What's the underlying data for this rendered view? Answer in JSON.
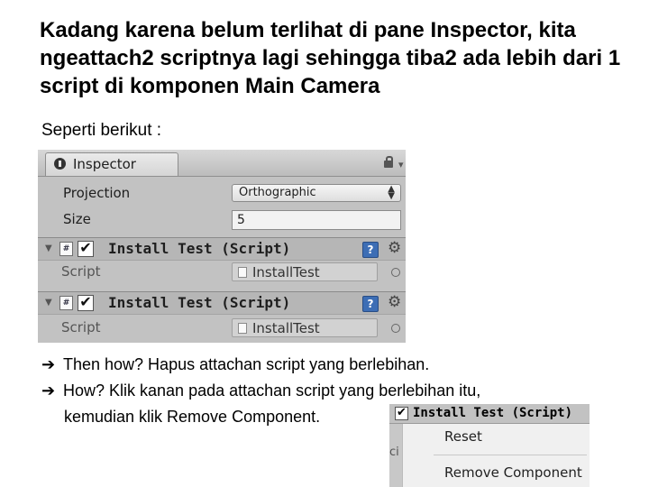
{
  "slide": {
    "heading": "Kadang karena belum terlihat di pane Inspector, kita ngeattach2 scriptnya lagi sehingga tiba2 ada lebih dari 1 script di komponen Main Camera",
    "subtitle": "Seperti berikut :",
    "bullets": [
      {
        "text": "Then how? Hapus attachan script yang berlebihan."
      },
      {
        "text": "How? Klik kanan pada attachan script yang berlebihan itu,",
        "continuation": "kemudian klik Remove Component."
      }
    ]
  },
  "inspector": {
    "tab_label": "Inspector",
    "projection_label": "Projection",
    "projection_value": "Orthographic",
    "size_label": "Size",
    "size_value": "5",
    "components": [
      {
        "title": "Install Test (Script)",
        "script_label": "Script",
        "script_value": "InstallTest",
        "enabled": "✔"
      },
      {
        "title": "Install Test (Script)",
        "script_label": "Script",
        "script_value": "InstallTest",
        "enabled": "✔"
      }
    ]
  },
  "context_menu": {
    "header_title": "Install Test (Script)",
    "strip_text": "ci",
    "items": [
      "Reset",
      "Remove Component"
    ]
  },
  "icons": {
    "bullet": "arrow-right-icon",
    "script": "cs-script-icon",
    "help": "help-book-icon",
    "gear": "gear-icon"
  },
  "colors": {
    "panel_bg": "#c2c2c2",
    "help_blue": "#3d6eb5"
  }
}
